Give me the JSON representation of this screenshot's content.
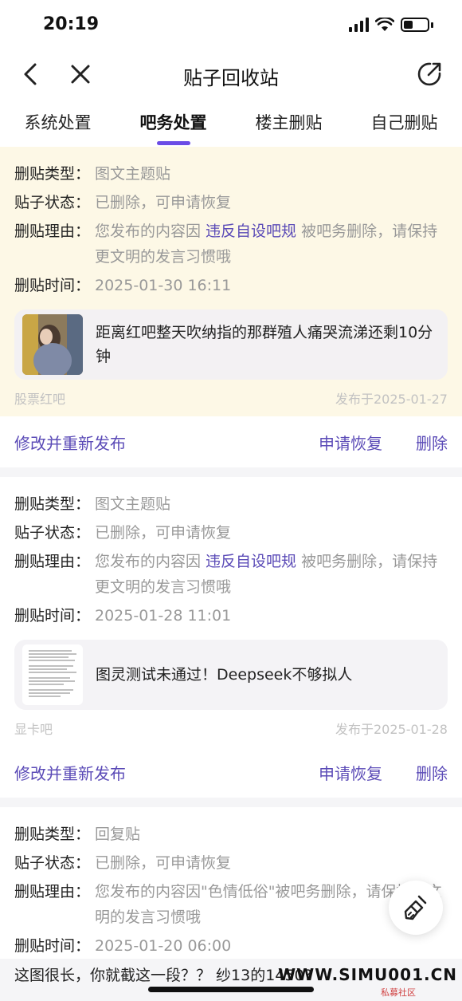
{
  "status_bar": {
    "time": "20:19"
  },
  "nav": {
    "title": "贴子回收站"
  },
  "tabs": [
    {
      "label": "系统处置",
      "active": false
    },
    {
      "label": "吧务处置",
      "active": true
    },
    {
      "label": "楼主删贴",
      "active": false
    },
    {
      "label": "自己删贴",
      "active": false
    }
  ],
  "labels": {
    "type": "删贴类型：",
    "status": "贴子状态：",
    "reason": "删贴理由：",
    "time": "删贴时间："
  },
  "cards": [
    {
      "type": "图文主题贴",
      "status": "已删除，可申请恢复",
      "reason_prefix": "您发布的内容因 ",
      "reason_link": "违反自设吧规",
      "reason_suffix": " 被吧务删除，请保持更文明的发言习惯哦",
      "time": "2025-01-30 16:11",
      "preview_text": "距离红吧整天吹纳指的那群殖人痛哭流涕还剩10分钟",
      "forum": "股票红吧",
      "published": "发布于2025-01-27",
      "actions": {
        "edit": "修改并重新发布",
        "recover": "申请恢复",
        "delete": "删除"
      }
    },
    {
      "type": "图文主题贴",
      "status": "已删除，可申请恢复",
      "reason_prefix": "您发布的内容因 ",
      "reason_link": "违反自设吧规",
      "reason_suffix": " 被吧务删除，请保持更文明的发言习惯哦",
      "time": "2025-01-28 11:01",
      "preview_text": "图灵测试未通过！Deepseek不够拟人",
      "forum": "显卡吧",
      "published": "发布于2025-01-28",
      "actions": {
        "edit": "修改并重新发布",
        "recover": "申请恢复",
        "delete": "删除"
      }
    },
    {
      "type": "回复贴",
      "status": "已删除，可申请恢复",
      "reason_full": "您发布的内容因\"色情低俗\"被吧务删除，请保持更文明的发言习惯哦",
      "time": "2025-01-20 06:00"
    }
  ],
  "bottom_text": "这图很长，你就截这一段？？ 纱13的1450?",
  "watermark": {
    "main": "WWW.SIMU001.CN",
    "sub": "私募社区"
  },
  "colors": {
    "accent": "#6b4ce6",
    "link": "#5b4bb7",
    "highlight_bg": "#fdf8e6"
  }
}
